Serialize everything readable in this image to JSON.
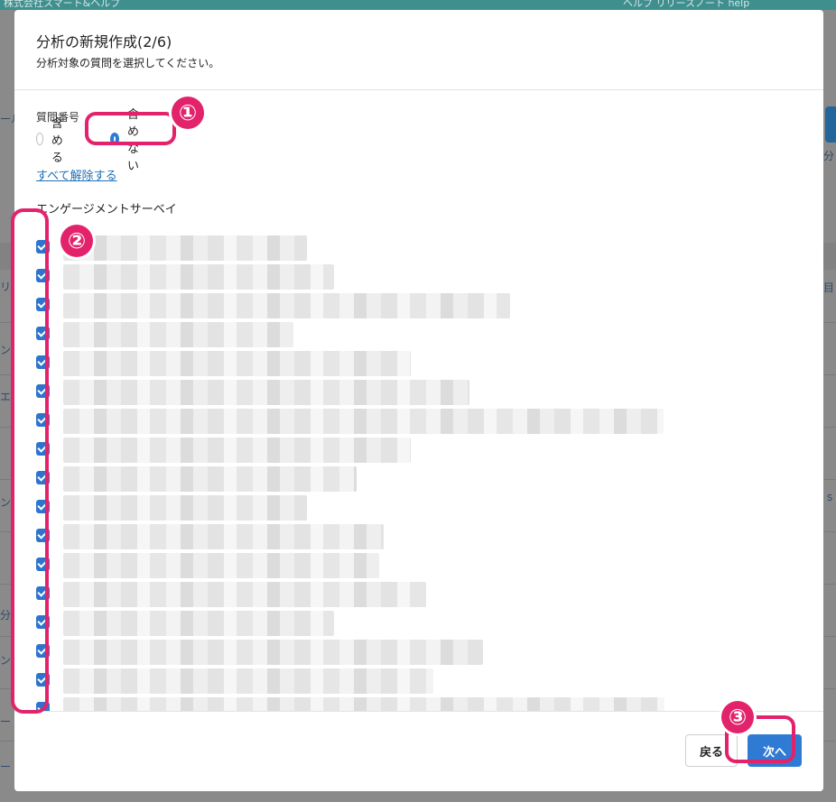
{
  "background": {
    "topbar": {
      "left_text": "株式会社スマート&ヘルプ",
      "right_text": "ヘルプ リリースノート help"
    },
    "fragments": [
      "ール",
      "リ",
      "ン",
      "エ",
      "ン",
      "分",
      "ン",
      "ー",
      "ー",
      "分",
      "目",
      "s"
    ]
  },
  "modal": {
    "title": "分析の新規作成(2/6)",
    "subtitle": "分析対象の質問を選択してください。",
    "question_number": {
      "label": "質問番号",
      "options": [
        {
          "label": "含める",
          "selected": false
        },
        {
          "label": "含めない",
          "selected": true
        }
      ]
    },
    "clear_all": "すべて解除する",
    "section": "エンゲージメントサーベイ",
    "items_checked": 17,
    "buttons": {
      "back": "戻る",
      "next": "次へ"
    }
  },
  "annotations": [
    "①",
    "②",
    "③"
  ],
  "colors": {
    "accent": "#2f7bd4",
    "highlight": "#e2236b",
    "link": "#1f6fb7"
  }
}
